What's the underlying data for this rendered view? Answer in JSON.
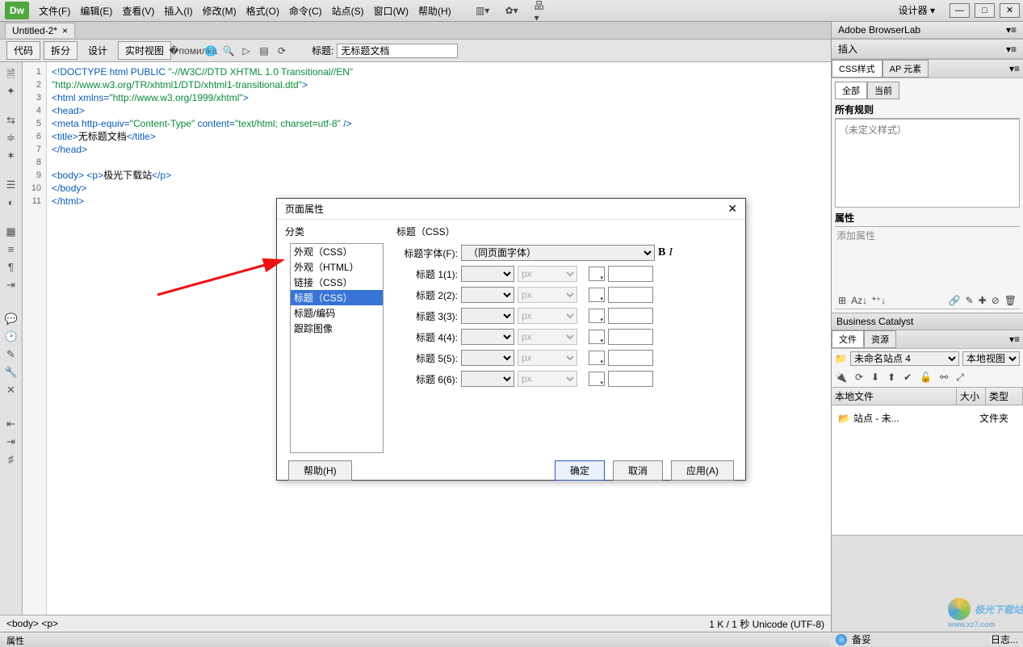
{
  "menu": {
    "items": [
      "文件(F)",
      "编辑(E)",
      "查看(V)",
      "插入(I)",
      "修改(M)",
      "格式(O)",
      "命令(C)",
      "站点(S)",
      "窗口(W)",
      "帮助(H)"
    ]
  },
  "designer_label": "设计器",
  "doc_tab": {
    "label": "Untitled-2*"
  },
  "view_buttons": [
    "代码",
    "拆分",
    "设计",
    "实时视图"
  ],
  "title_label": "标题:",
  "title_value": "无标题文档",
  "line_numbers": [
    "1",
    "2",
    "3",
    "4",
    "5",
    "6",
    "7",
    "8",
    "9",
    "10",
    "11"
  ],
  "code": {
    "l1a": "<!DOCTYPE html PUBLIC ",
    "l1b": "\"-//W3C//DTD XHTML 1.0 Transitional//EN\"",
    "l1c": "\"http://www.w3.org/TR/xhtml1/DTD/xhtml1-transitional.dtd\"",
    "l1d": ">",
    "l2a": "<html xmlns=",
    "l2b": "\"http://www.w3.org/1999/xhtml\"",
    "l2c": ">",
    "l3": "<head>",
    "l4a": "<meta http-equiv=",
    "l4b": "\"Content-Type\"",
    "l4c": " content=",
    "l4d": "\"text/html; charset=utf-8\"",
    "l4e": " />",
    "l5a": "<title>",
    "l5b": "无标题文档",
    "l5c": "</title>",
    "l6": "</head>",
    "l8a": "<body>",
    "l8b": " <p>",
    "l8c": "极光下载站",
    "l8d": "</p>",
    "l9": "</body>",
    "l10": "</html>"
  },
  "status": {
    "path": "<body> <p>",
    "right": "1 K / 1 秒 Unicode (UTF-8)"
  },
  "props_label": "属性",
  "panels": {
    "browserlab": "Adobe BrowserLab",
    "insert": "插入",
    "css_tab": "CSS样式",
    "ap_tab": "AP 元素",
    "all": "全部",
    "current": "当前",
    "all_rules": "所有规则",
    "no_style": "（未定义样式）",
    "properties": "属性",
    "add_property": "添加属性",
    "bc": "Business Catalyst",
    "files_tab": "文件",
    "assets_tab": "资源",
    "site_name": "未命名站点 4",
    "view_mode": "本地视图",
    "col_local": "本地文件",
    "col_size": "大小",
    "col_type": "类型",
    "root_folder": "站点 - 未...",
    "root_type": "文件夹",
    "standby": "备妥",
    "log": "日志..."
  },
  "dialog": {
    "title": "页面属性",
    "category_label": "分类",
    "categories": [
      "外观（CSS）",
      "外观（HTML）",
      "链接（CSS）",
      "标题（CSS）",
      "标题/编码",
      "跟踪图像"
    ],
    "selected_index": 3,
    "section": "标题（CSS）",
    "font_label": "标题字体(F):",
    "font_value": "（同页面字体）",
    "rows": [
      {
        "label": "标题 1(1):"
      },
      {
        "label": "标题 2(2):"
      },
      {
        "label": "标题 3(3):"
      },
      {
        "label": "标题 4(4):"
      },
      {
        "label": "标题 5(5):"
      },
      {
        "label": "标题 6(6):"
      }
    ],
    "unit": "px",
    "help": "帮助(H)",
    "ok": "确定",
    "cancel": "取消",
    "apply": "应用(A)"
  },
  "watermark": {
    "name": "极光下载站",
    "url": "www.xz7.com"
  }
}
